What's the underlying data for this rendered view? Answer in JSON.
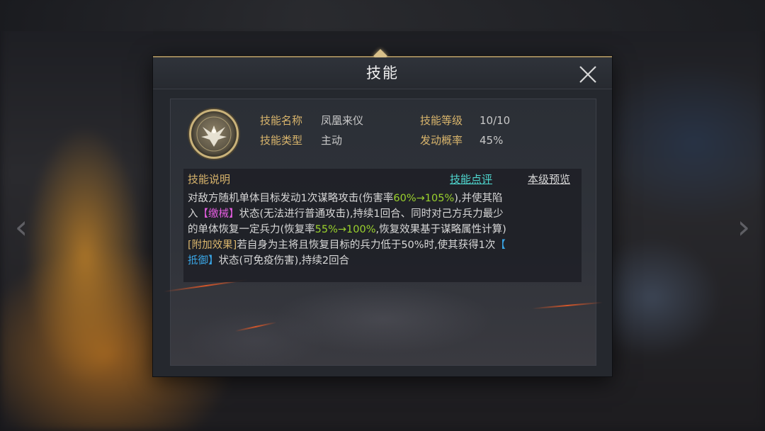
{
  "dialog": {
    "title": "技能"
  },
  "skill": {
    "icon": "phoenix-icon",
    "name_label": "技能名称",
    "name_value": "凤凰来仪",
    "type_label": "技能类型",
    "type_value": "主动",
    "level_label": "技能等级",
    "level_value": "10/10",
    "rate_label": "发动概率",
    "rate_value": "45%"
  },
  "description": {
    "title": "技能说明",
    "review_link": "技能点评",
    "preview_link": "本级预览",
    "line1": {
      "a": "对敌方随机单体目标发动1次谋略攻击(伤害率",
      "b": "60%→105%",
      "c": "),并使其陷"
    },
    "line2": {
      "a": "入",
      "b": "【缴械】",
      "c": "状态(无法进行普通攻击),持续1回合、同时对己方兵力最少"
    },
    "line3": {
      "a": "的单体恢复一定兵力(恢复率",
      "b": "55%→100%",
      "c": ",恢复效果基于谋略属性计算)"
    },
    "line4": {
      "a": "[附加效果]",
      "b": "若自身为主将且恢复目标的兵力低于50%时,使其获得1次",
      "c": "【"
    },
    "line5": {
      "a": "抵御】",
      "b": "状态(可免疫伤害),持续2回合"
    }
  },
  "colors": {
    "gold": "#d9b56c",
    "green": "#9bd22d",
    "pink": "#e45de0",
    "blue": "#3aa6e6",
    "review_link": "#4fd7cf",
    "preview_link": "#d8d8d8"
  }
}
